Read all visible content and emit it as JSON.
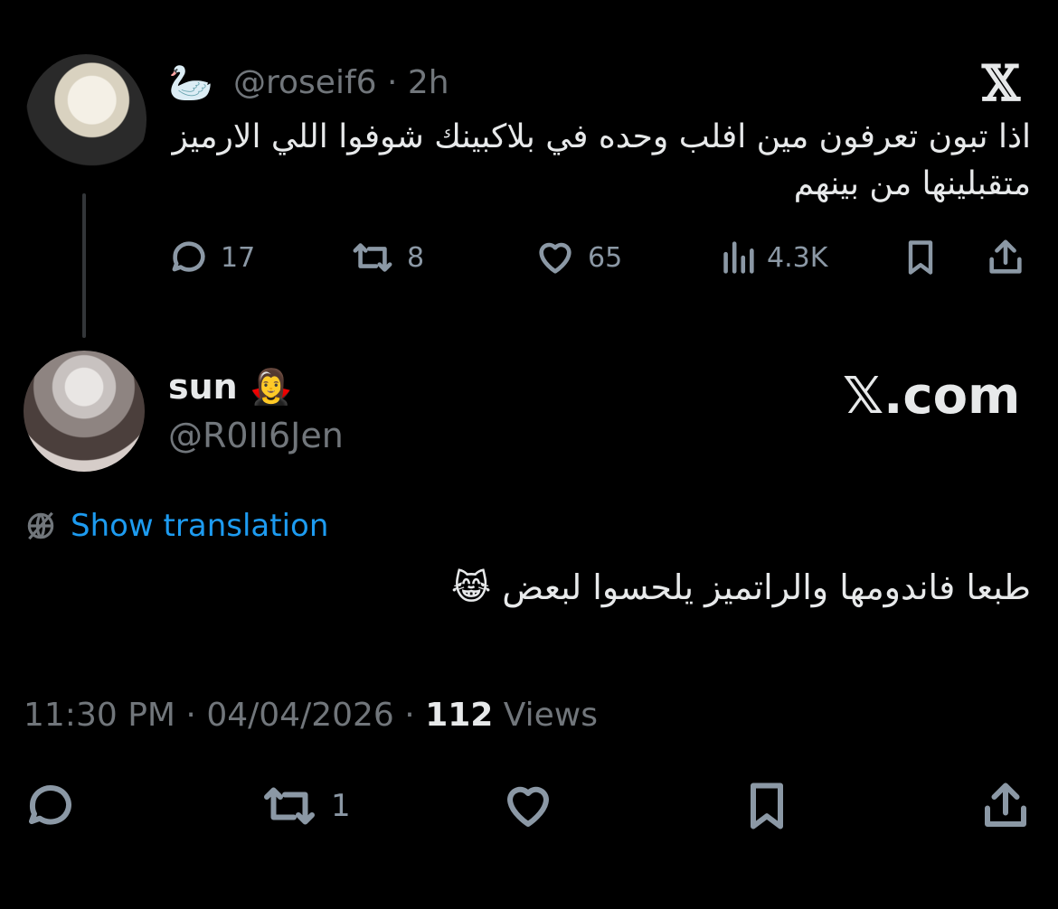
{
  "parent": {
    "emoji": "🦢",
    "handle": "@roseif6",
    "sep": "·",
    "time": "2h",
    "text": "اذا تبون تعرفون مين افلب وحده في بلاكبينك شوفوا اللي الارميز متقبلينها من بينهم",
    "x_logo": "𝕏",
    "stats": {
      "replies": "17",
      "reposts": "8",
      "likes": "65",
      "views": "4.3K"
    }
  },
  "reply": {
    "name": "sun",
    "name_emoji": "🧛‍♀️",
    "handle": "@R0II6Jen",
    "brand": "𝕏.com",
    "translate_label": "Show translation",
    "text": "طبعا فاندومها والراتميز يلحسوا لبعض 😹",
    "time": "11:30 PM",
    "date": "04/04/2026",
    "sep": "·",
    "views_count": "112",
    "views_label": "Views",
    "reposts": "1"
  },
  "colors": {
    "accent": "#1d9bf0",
    "muted": "#71767b",
    "background": "#000000",
    "text": "#e7e9ea"
  }
}
